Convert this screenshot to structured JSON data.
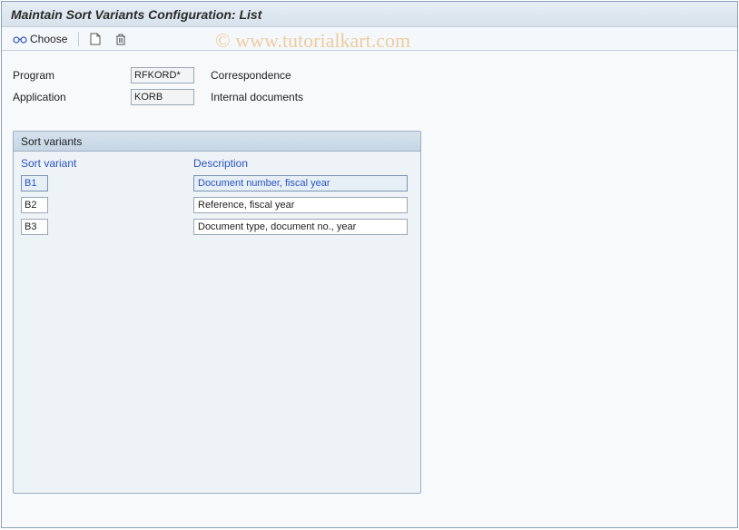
{
  "title": "Maintain Sort Variants Configuration: List",
  "watermark": "© www.tutorialkart.com",
  "toolbar": {
    "choose_label": "Choose"
  },
  "meta": {
    "program_label": "Program",
    "program_value": "RFKORD*",
    "program_desc": "Correspondence",
    "application_label": "Application",
    "application_value": "KORB",
    "application_desc": "Internal documents"
  },
  "panel": {
    "header": "Sort variants",
    "col_variant": "Sort variant",
    "col_desc": "Description",
    "rows": [
      {
        "variant": "B1",
        "desc": "Document number, fiscal year",
        "selected": true
      },
      {
        "variant": "B2",
        "desc": "Reference, fiscal year",
        "selected": false
      },
      {
        "variant": "B3",
        "desc": "Document type, document no., year",
        "selected": false
      }
    ]
  }
}
